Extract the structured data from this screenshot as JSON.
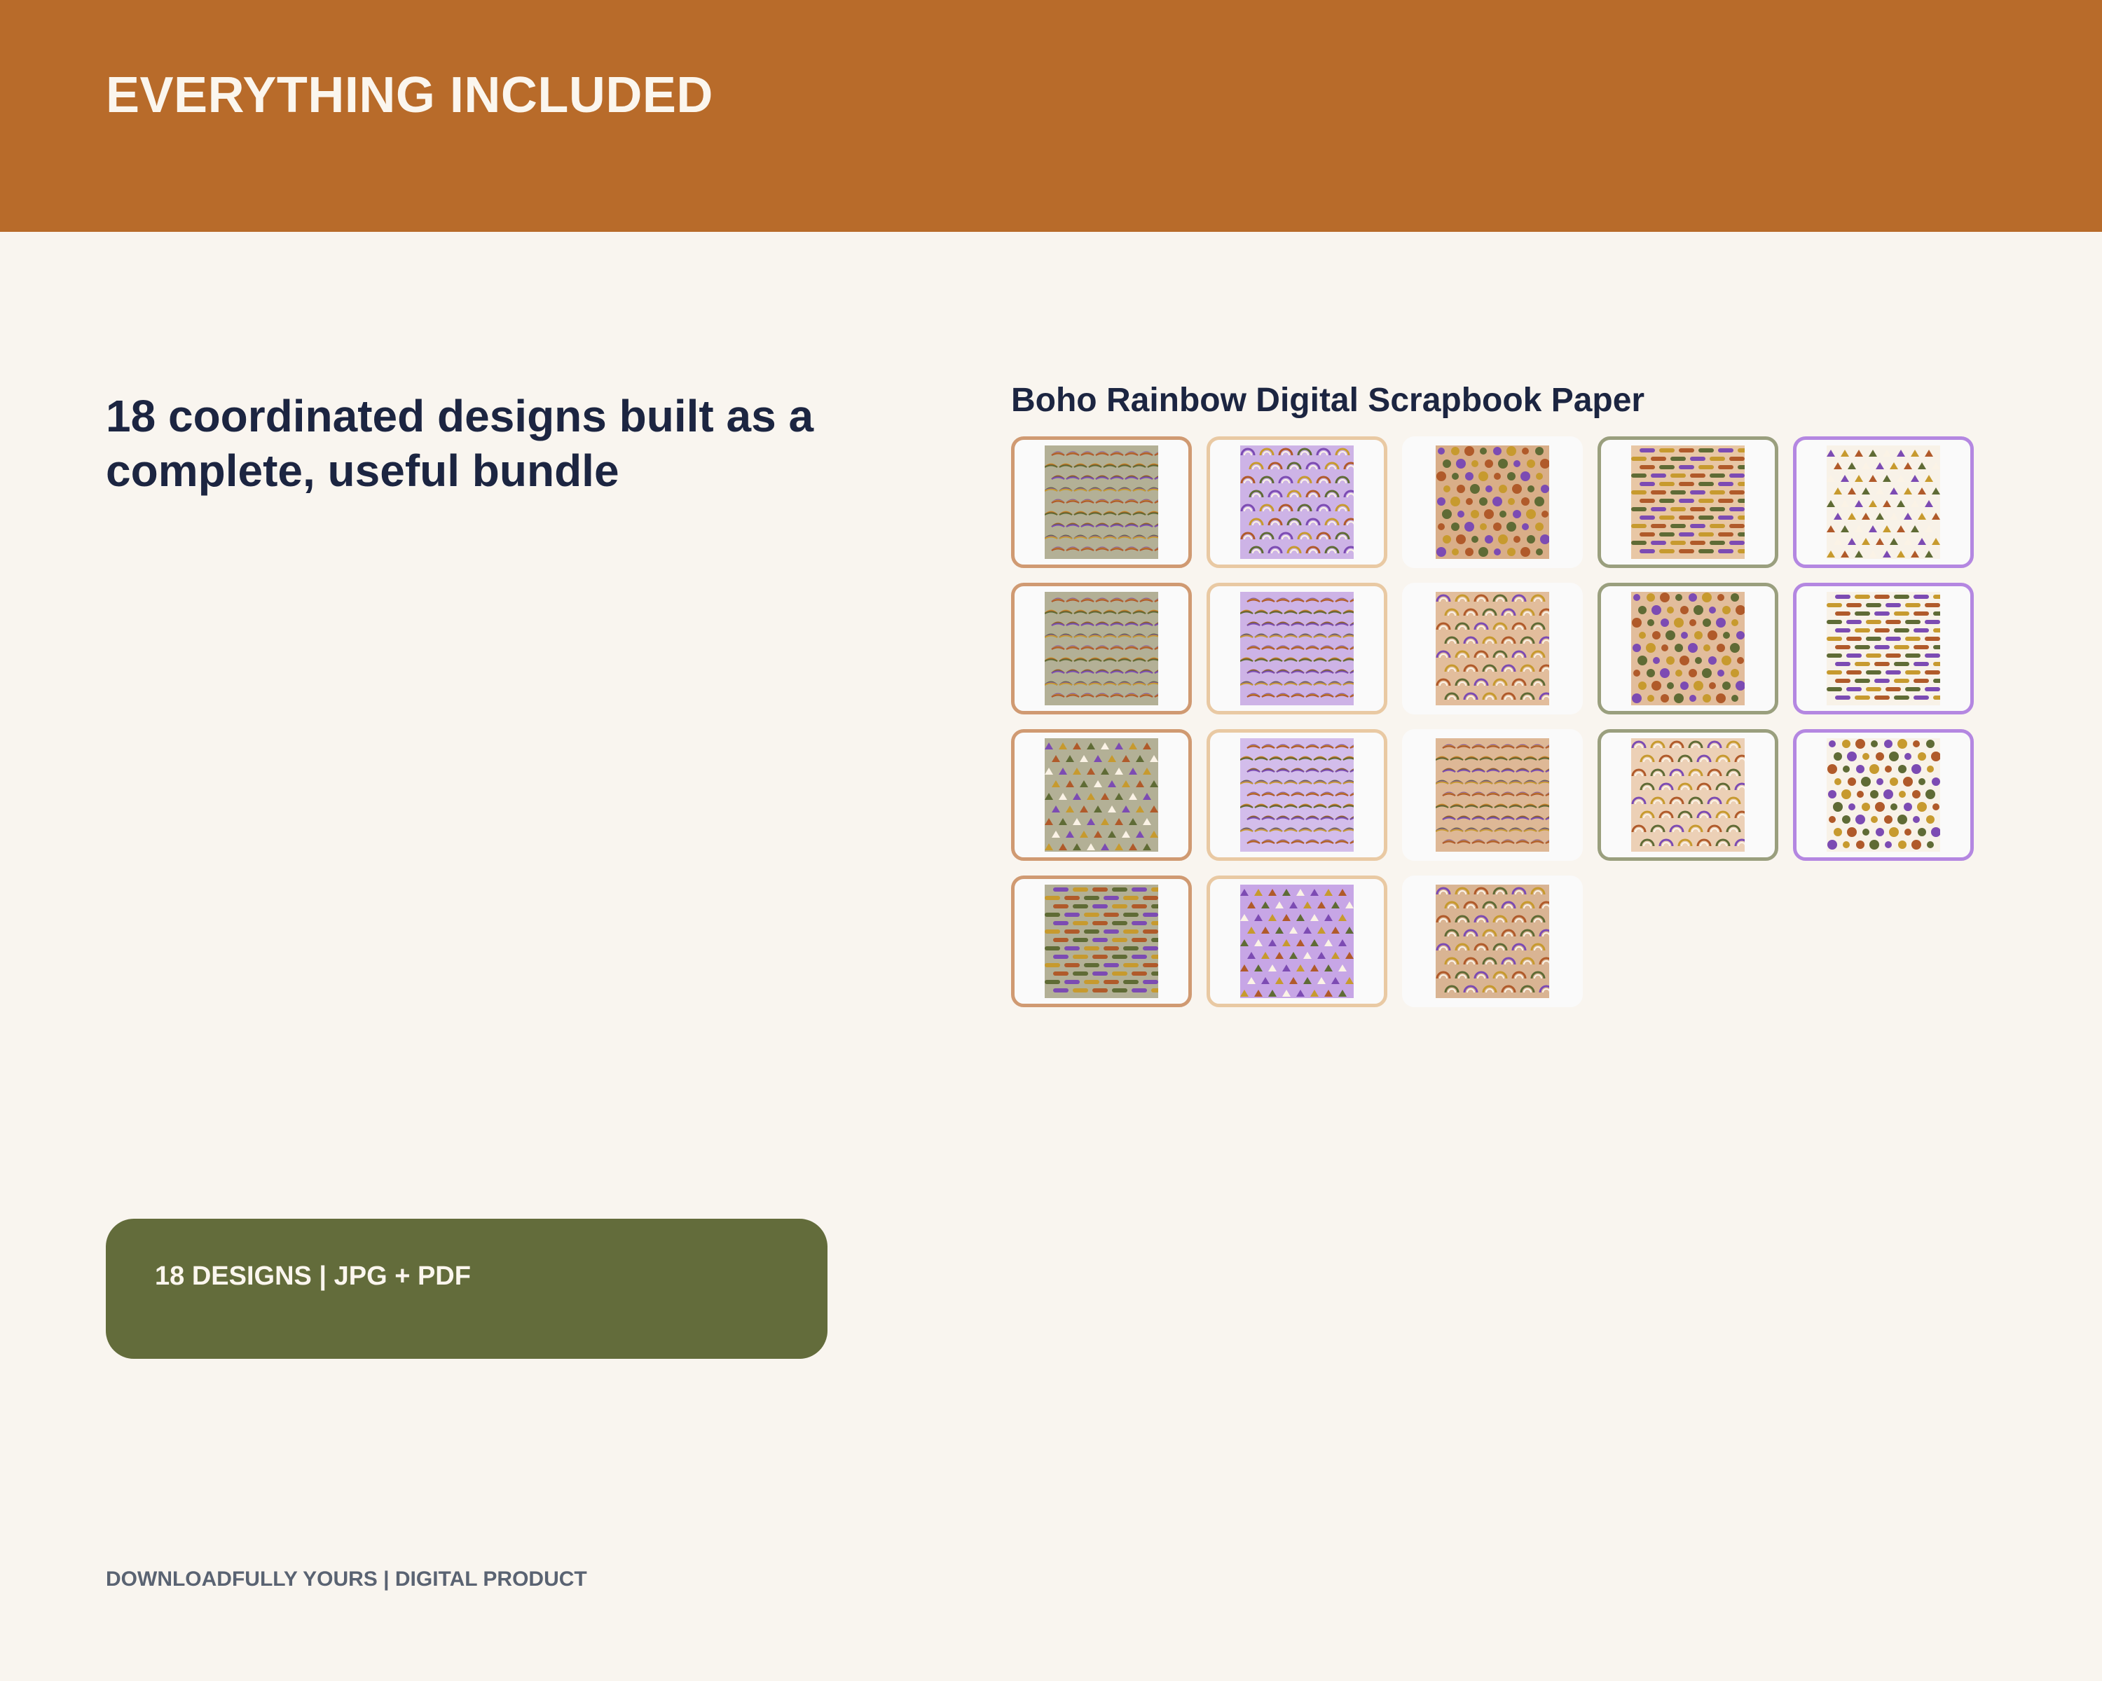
{
  "header": {
    "title": "EVERYTHING INCLUDED",
    "color": "#b86b2a"
  },
  "main": {
    "headline": "18 coordinated designs built as a complete, useful bundle"
  },
  "papers": {
    "title": "Boho Rainbow Digital Scrapbook Paper",
    "count": 18,
    "items": [
      {
        "pattern": "rainbow-stripes",
        "bg": "#b3b096",
        "frame": "#d09a72"
      },
      {
        "pattern": "rainbow-arches",
        "bg": "#cdb3e6",
        "frame": "#e9c9a3"
      },
      {
        "pattern": "dots-blobs",
        "bg": "#d9ae88",
        "frame": "#fafafa"
      },
      {
        "pattern": "dash-rows",
        "bg": "#e8c7a5",
        "frame": "#9a9f7e"
      },
      {
        "pattern": "triangles",
        "bg": "#f8f2e8",
        "frame": "#b487e1"
      },
      {
        "pattern": "rainbow-stripes",
        "bg": "#b3b096",
        "frame": "#d09a72"
      },
      {
        "pattern": "rainbow-stripes",
        "bg": "#cdb3e6",
        "frame": "#e9c9a3"
      },
      {
        "pattern": "rainbow-arches",
        "bg": "#e2bd9c",
        "frame": "#fafafa"
      },
      {
        "pattern": "dots-blobs",
        "bg": "#e2bd9c",
        "frame": "#9a9f7e"
      },
      {
        "pattern": "dash-rows",
        "bg": "#f8f2e8",
        "frame": "#b487e1"
      },
      {
        "pattern": "triangles",
        "bg": "#b3b096",
        "frame": "#d09a72"
      },
      {
        "pattern": "rainbow-stripes",
        "bg": "#d3bdeb",
        "frame": "#e9c9a3"
      },
      {
        "pattern": "rainbow-stripes",
        "bg": "#deb896",
        "frame": "#fafafa"
      },
      {
        "pattern": "rainbow-arches",
        "bg": "#ecd0b6",
        "frame": "#9a9f7e"
      },
      {
        "pattern": "dots-blobs",
        "bg": "#f8f2e8",
        "frame": "#b487e1"
      },
      {
        "pattern": "dash-rows",
        "bg": "#b3b096",
        "frame": "#d09a72"
      },
      {
        "pattern": "triangles",
        "bg": "#c7a6e6",
        "frame": "#e9c9a3"
      },
      {
        "pattern": "rainbow-arches",
        "bg": "#d9b493",
        "frame": "#fafafa"
      }
    ]
  },
  "badge": {
    "text": "18 DESIGNS | JPG + PDF",
    "color": "#636c3b"
  },
  "footer": {
    "text": "DOWNLOADFULLY YOURS | DIGITAL PRODUCT"
  },
  "palette": {
    "purple": "#7c4bb3",
    "mustard": "#c79a2e",
    "rust": "#b05a2a",
    "olive": "#5f6b35",
    "cream": "#fbf3e6"
  }
}
